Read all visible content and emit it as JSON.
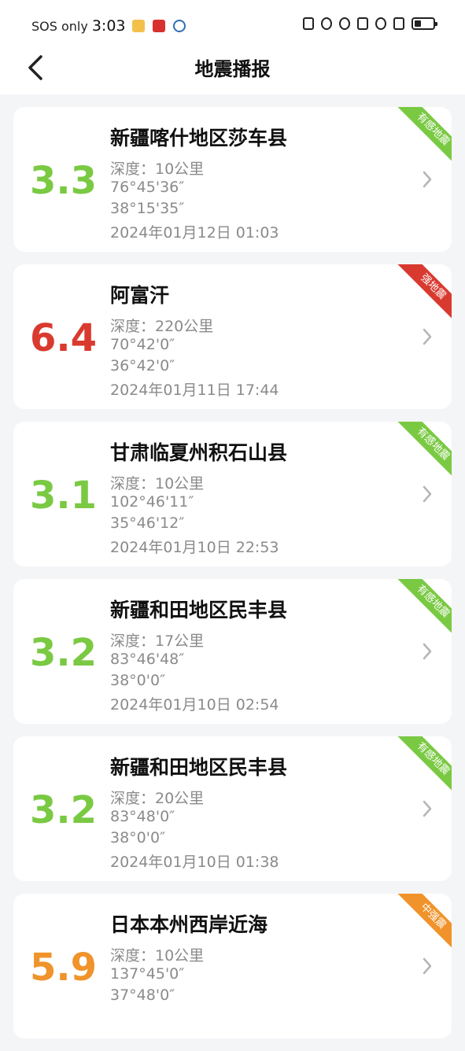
{
  "status_bar": {
    "carrier": "SOS only",
    "time": "3:03"
  },
  "header": {
    "title": "地震播报"
  },
  "colors": {
    "feltable": "#7ac943",
    "strong": "#d93a2f",
    "medium": "#f0932b"
  },
  "events": [
    {
      "magnitude": "3.3",
      "place": "新疆喀什地区莎车县",
      "depth": "深度：10公里",
      "longitude": "76°45'36″",
      "latitude": "38°15'35″",
      "time": "2024年01月12日 01:03",
      "tag": "有感地震",
      "color": "#7ac943"
    },
    {
      "magnitude": "6.4",
      "place": "阿富汗",
      "depth": "深度：220公里",
      "longitude": "70°42'0″",
      "latitude": "36°42'0″",
      "time": "2024年01月11日 17:44",
      "tag": "强地震",
      "color": "#d93a2f"
    },
    {
      "magnitude": "3.1",
      "place": "甘肃临夏州积石山县",
      "depth": "深度：10公里",
      "longitude": "102°46'11″",
      "latitude": "35°46'12″",
      "time": "2024年01月10日 22:53",
      "tag": "有感地震",
      "color": "#7ac943"
    },
    {
      "magnitude": "3.2",
      "place": "新疆和田地区民丰县",
      "depth": "深度：17公里",
      "longitude": "83°46'48″",
      "latitude": "38°0'0″",
      "time": "2024年01月10日 02:54",
      "tag": "有感地震",
      "color": "#7ac943"
    },
    {
      "magnitude": "3.2",
      "place": "新疆和田地区民丰县",
      "depth": "深度：20公里",
      "longitude": "83°48'0″",
      "latitude": "38°0'0″",
      "time": "2024年01月10日 01:38",
      "tag": "有感地震",
      "color": "#7ac943"
    },
    {
      "magnitude": "5.9",
      "place": "日本本州西岸近海",
      "depth": "深度：10公里",
      "longitude": "137°45'0″",
      "latitude": "37°48'0″",
      "time": "",
      "tag": "中强震",
      "color": "#f0932b"
    }
  ]
}
